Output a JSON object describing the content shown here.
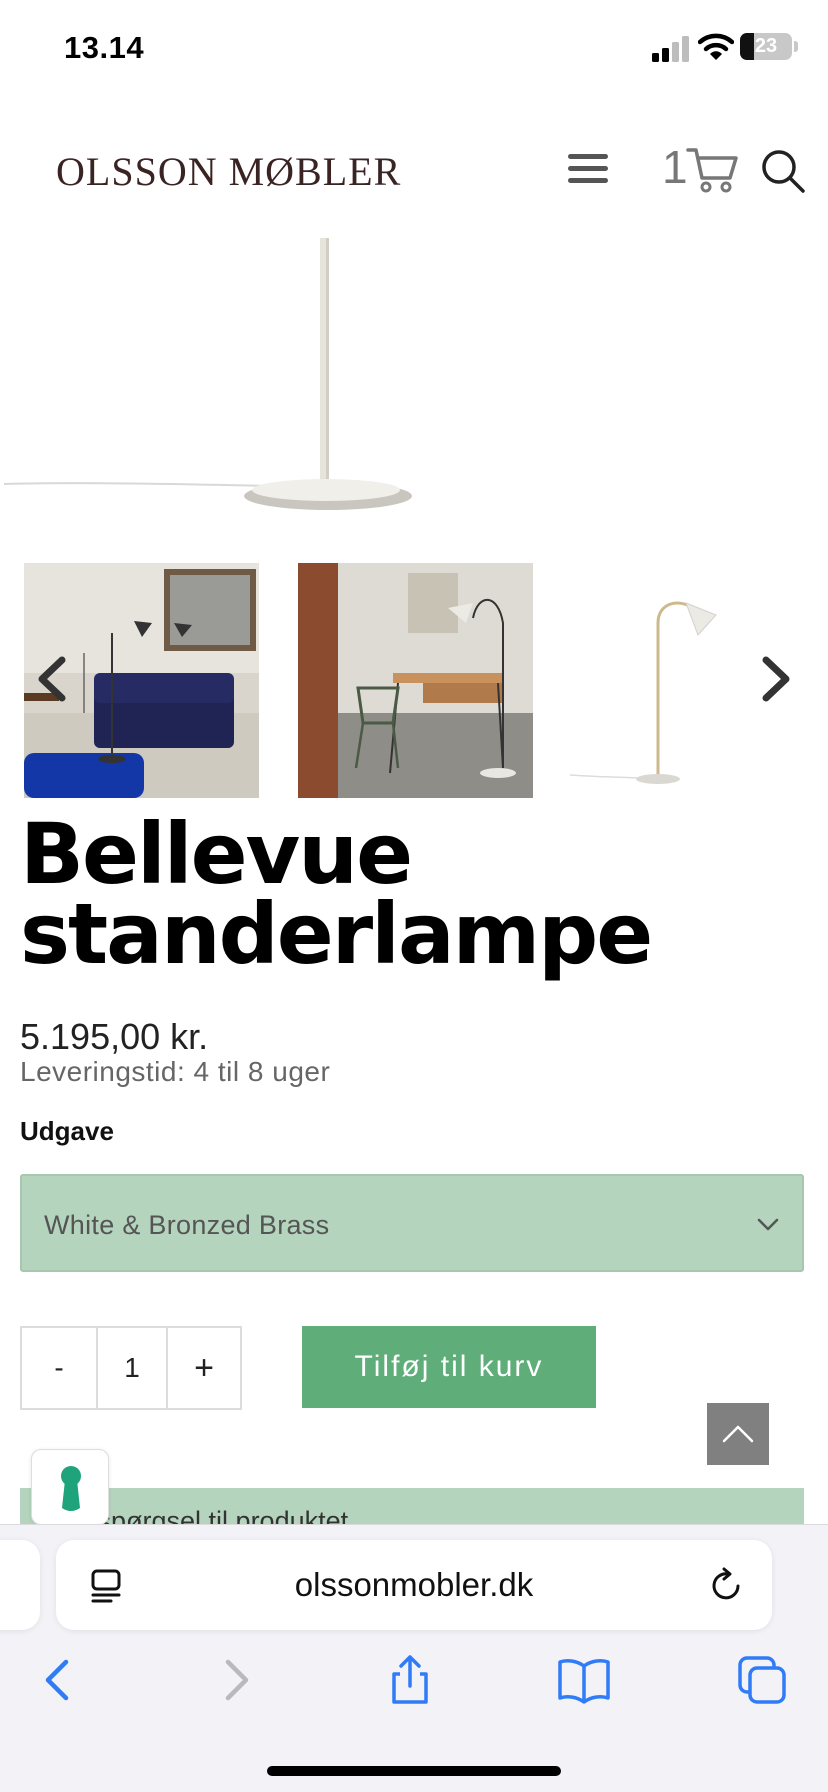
{
  "status_bar": {
    "time": "13.14",
    "battery": "23"
  },
  "header": {
    "logo": "OLSSON MØBLER",
    "cart_count": "1"
  },
  "product": {
    "title": "Bellevue standerlampe",
    "price": "5.195,00 kr.",
    "delivery": "Leveringstid: 4 til 8 uger",
    "variant_label": "Udgave",
    "variant_selected": "White & Bronzed Brass",
    "quantity": "1",
    "qty_minus": "-",
    "qty_plus": "+",
    "add_to_cart": "Tilføj til kurv",
    "inquiry": "Forespørgsel til produktet"
  },
  "browser": {
    "url": "olssonmobler.dk"
  },
  "colors": {
    "accent_green": "#5fae79",
    "select_green": "#b5d4bd",
    "logo_color": "#3a2323",
    "ios_blue": "#2f7cf6"
  }
}
